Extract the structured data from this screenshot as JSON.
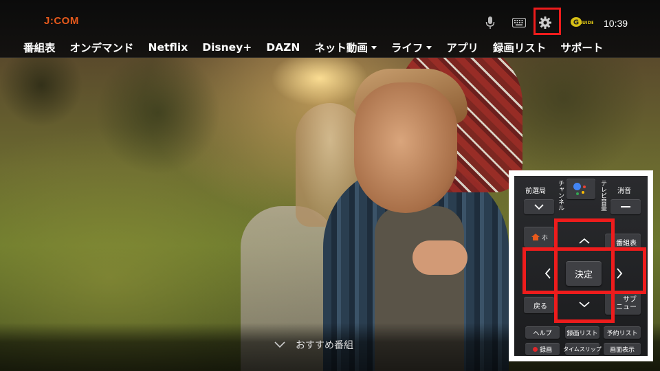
{
  "app": {
    "brand": "J:COM",
    "clock": "10:39",
    "guide_badge": "GUIDE"
  },
  "top_icons": [
    {
      "name": "microphone-icon"
    },
    {
      "name": "keyboard-icon"
    },
    {
      "name": "gear-icon"
    }
  ],
  "nav": {
    "items": [
      {
        "label": "番組表",
        "dropdown": false
      },
      {
        "label": "オンデマンド",
        "dropdown": false
      },
      {
        "label": "Netflix",
        "dropdown": false
      },
      {
        "label": "Disney+",
        "dropdown": false
      },
      {
        "label": "DAZN",
        "dropdown": false
      },
      {
        "label": "ネット動画",
        "dropdown": true
      },
      {
        "label": "ライフ",
        "dropdown": true
      },
      {
        "label": "アプリ",
        "dropdown": false
      },
      {
        "label": "録画リスト",
        "dropdown": false
      },
      {
        "label": "サポート",
        "dropdown": false
      }
    ]
  },
  "bottom": {
    "recommend_label": "おすすめ番組"
  },
  "remote": {
    "prev_channel": "前選局",
    "channel_vertical": "チャンネル",
    "tv_volume_vertical": "テレビ音量",
    "mute": "消音",
    "home_label": "ホ",
    "guide": "番組表",
    "ok": "決定",
    "back": "戻る",
    "menu_top": "サブ",
    "menu_bottom": "ニュー",
    "help": "ヘルプ",
    "rec_list": "録画リスト",
    "reserve_list": "予約リスト",
    "record": "録画",
    "time_slip": "タイムスリップ",
    "screen_display": "画面表示"
  },
  "colors": {
    "brand_orange": "#e85a1c",
    "highlight_red": "#ee1c1c",
    "topbar_bg": "#0b0b0b"
  }
}
